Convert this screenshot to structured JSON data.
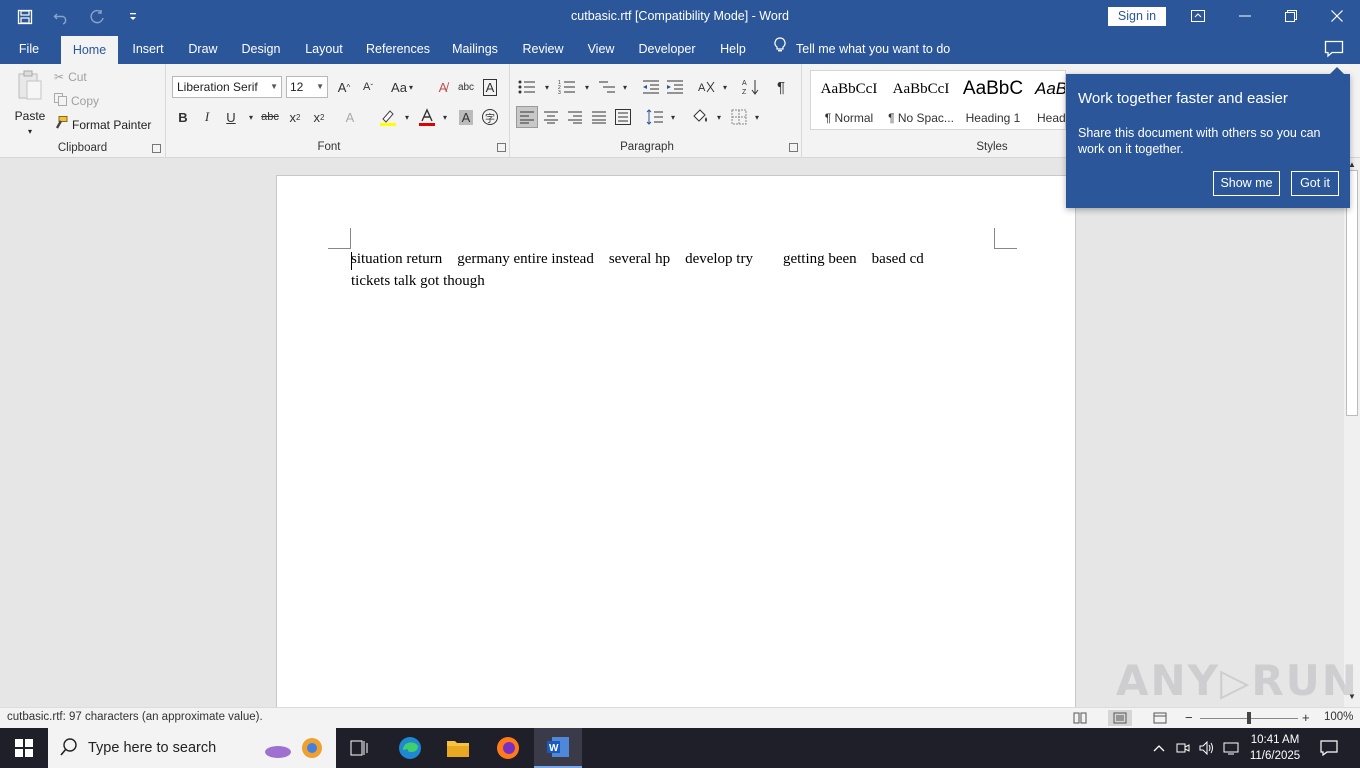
{
  "window": {
    "title": "cutbasic.rtf [Compatibility Mode]  -  Word",
    "sign_in": "Sign in"
  },
  "tabs": [
    {
      "label": "File"
    },
    {
      "label": "Home"
    },
    {
      "label": "Insert"
    },
    {
      "label": "Draw"
    },
    {
      "label": "Design"
    },
    {
      "label": "Layout"
    },
    {
      "label": "References"
    },
    {
      "label": "Mailings"
    },
    {
      "label": "Review"
    },
    {
      "label": "View"
    },
    {
      "label": "Developer"
    },
    {
      "label": "Help"
    }
  ],
  "tell_me": "Tell me what you want to do",
  "clipboard": {
    "paste": "Paste",
    "cut": "Cut",
    "copy": "Copy",
    "format_painter": "Format Painter",
    "label": "Clipboard"
  },
  "font": {
    "family": "Liberation Serif",
    "size": "12",
    "label": "Font",
    "change_case": "Aa"
  },
  "paragraph": {
    "label": "Paragraph"
  },
  "styles": {
    "label": "Styles",
    "items": [
      {
        "sample": "AaBbCcI",
        "name": "¶ Normal"
      },
      {
        "sample": "AaBbCcI",
        "name": "¶ No Spac..."
      },
      {
        "sample": "AaBbC",
        "name": "Heading 1"
      },
      {
        "sample": "AaB",
        "name": "Head"
      }
    ]
  },
  "popup": {
    "title": "Work together faster and easier",
    "body": "Share this document with others so you can work on it together.",
    "show_me": "Show me",
    "got_it": "Got it"
  },
  "document": {
    "lines": [
      "situation return    germany entire instead    several hp    develop try        getting been    based cd",
      "tickets talk got though"
    ]
  },
  "status": {
    "text": "cutbasic.rtf: 97 characters (an approximate value).",
    "zoom": "100%"
  },
  "taskbar": {
    "search_placeholder": "Type here to search",
    "time": "10:41 AM",
    "date": "11/6/2025"
  },
  "watermark": "ANY RUN"
}
